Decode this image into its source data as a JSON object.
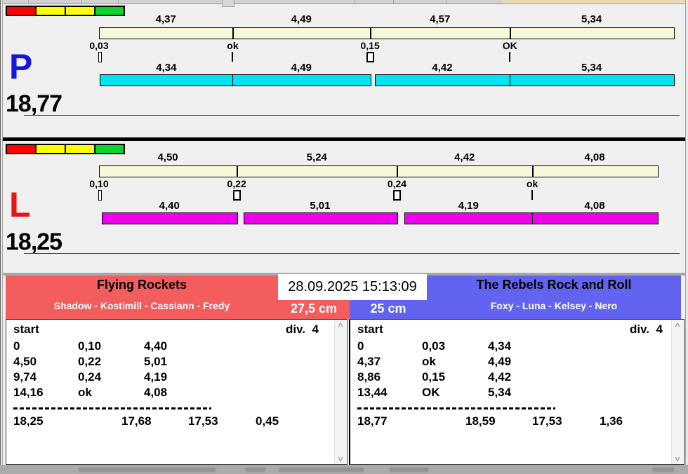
{
  "panels": [
    {
      "lane": "P",
      "lane_color": "#1616d6",
      "run_bar_color": "#00e4f0",
      "total": "18,77",
      "start_lights": [
        "#ff0000",
        "#ffff00",
        "#ffff00",
        "#0bd42c"
      ],
      "dogs": [
        {
          "split": "4,37",
          "delay": "0,03",
          "run": "4,34"
        },
        {
          "split": "4,49",
          "delay": "ok",
          "run": "4,49"
        },
        {
          "split": "4,57",
          "delay": "0,15",
          "run": "4,42"
        },
        {
          "split": "5,34",
          "delay": "OK",
          "run": "5,34"
        }
      ]
    },
    {
      "lane": "L",
      "lane_color": "#e21717",
      "run_bar_color": "#ee00ee",
      "total": "18,25",
      "start_lights": [
        "#ff0000",
        "#ffff00",
        "#ffff00",
        "#0bd42c"
      ],
      "dogs": [
        {
          "split": "4,50",
          "delay": "0,10",
          "run": "4,40"
        },
        {
          "split": "5,24",
          "delay": "0,22",
          "run": "5,01"
        },
        {
          "split": "4,42",
          "delay": "0,24",
          "run": "4,19"
        },
        {
          "split": "4,08",
          "delay": "ok",
          "run": "4,08"
        }
      ]
    }
  ],
  "scoreboard": {
    "datetime": "28.09.2025 15:13:09",
    "left": {
      "team": "Flying Rockets",
      "dogs": "Shadow - Kostimill - Cassiann - Fredy",
      "height": "27,5 cm",
      "header_color": "#f45d5e",
      "table": {
        "start_label": "start",
        "division": "div.  4",
        "rows": [
          [
            "0",
            "0,10",
            "4,40"
          ],
          [
            "4,50",
            "0,22",
            "5,01"
          ],
          [
            "9,74",
            "0,24",
            "4,19"
          ],
          [
            "14,16",
            "ok",
            "4,08"
          ]
        ],
        "totals": [
          "18,25",
          "17,68",
          "17,53",
          "0,45"
        ]
      }
    },
    "right": {
      "team": "The Rebels Rock and Roll",
      "dogs": "Foxy - Luna - Kelsey - Nero",
      "height": "25 cm",
      "header_color": "#6263f1",
      "table": {
        "start_label": "start",
        "division": "div.  4",
        "rows": [
          [
            "0",
            "0,03",
            "4,34"
          ],
          [
            "4,37",
            "ok",
            "4,49"
          ],
          [
            "8,86",
            "0,15",
            "4,42"
          ],
          [
            "13,44",
            "OK",
            "5,34"
          ]
        ],
        "totals": [
          "18,77",
          "18,59",
          "17,53",
          "1,36"
        ]
      }
    }
  }
}
